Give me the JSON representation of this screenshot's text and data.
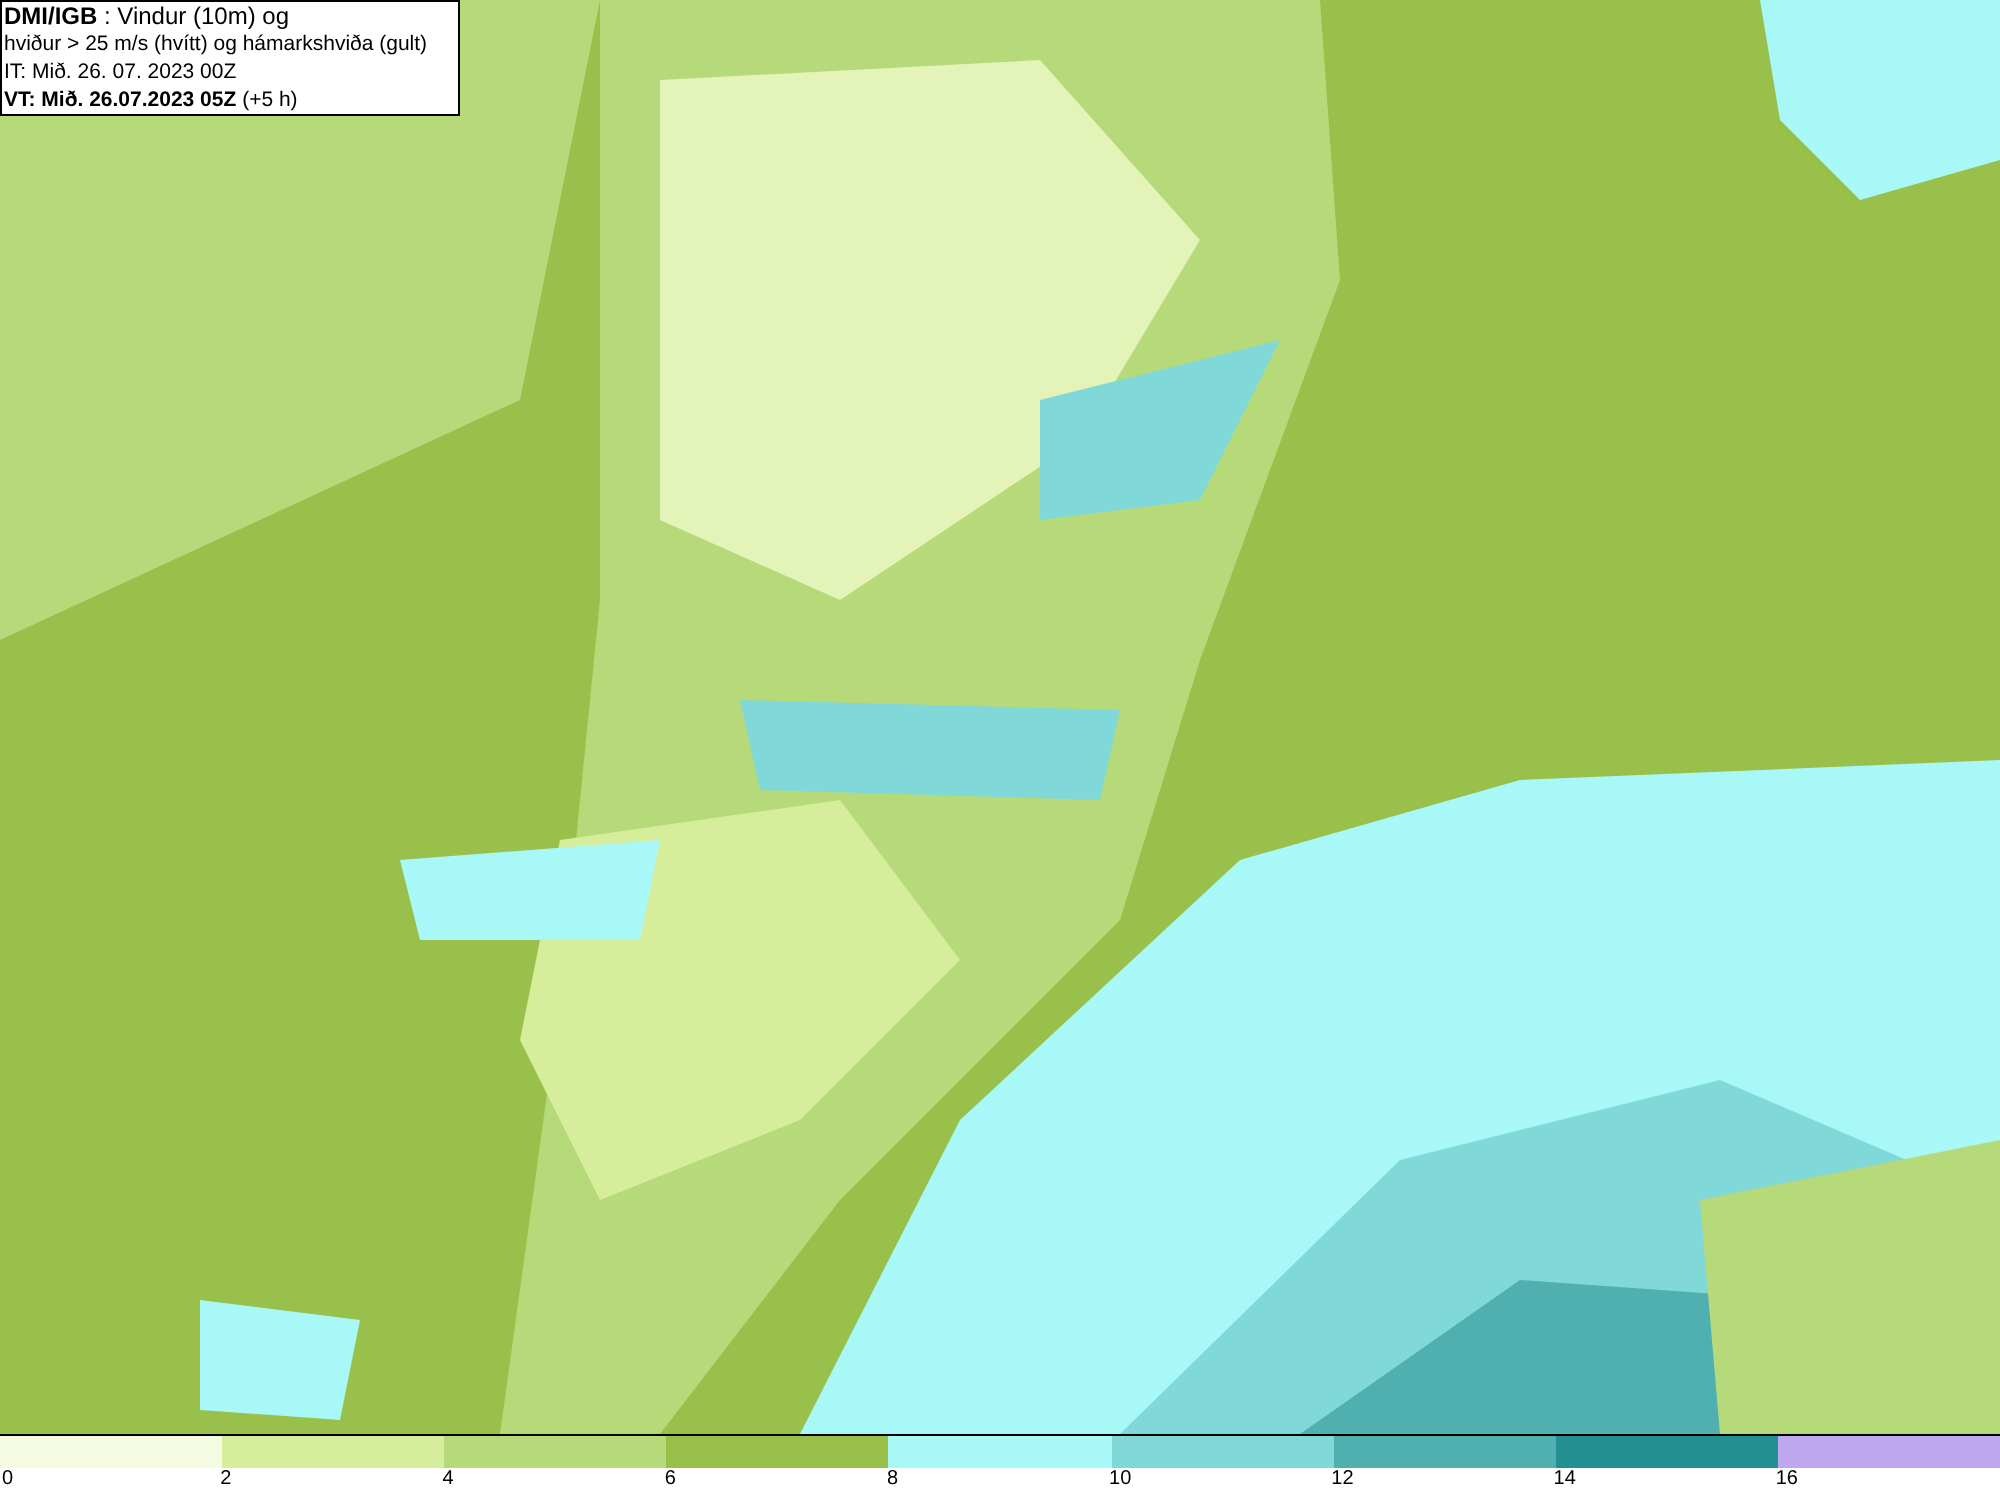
{
  "legend": {
    "lines": [
      "**DMI/IGB** : Vindur (10m) og",
      "hviður > 25 m/s (hvítt) og hámarkshviða (gult)",
      "IT: Mið. 26. 07. 2023 00Z",
      "**VT: Mið. 26.07.2023 05Z** (+5 h)"
    ]
  },
  "colorbar": [
    {
      "label": "0",
      "color": "#f5fbe0"
    },
    {
      "label": "2",
      "color": "#d6ee9c"
    },
    {
      "label": "4",
      "color": "#b6d97a"
    },
    {
      "label": "6",
      "color": "#98bf48"
    },
    {
      "label": "8",
      "color": "#a8f8f8"
    },
    {
      "label": "10",
      "color": "#80d8d8"
    },
    {
      "label": "12",
      "color": "#50b0b0"
    },
    {
      "label": "14",
      "color": "#229090"
    },
    {
      "label": "16",
      "color": "#c0a8f0"
    }
  ]
}
